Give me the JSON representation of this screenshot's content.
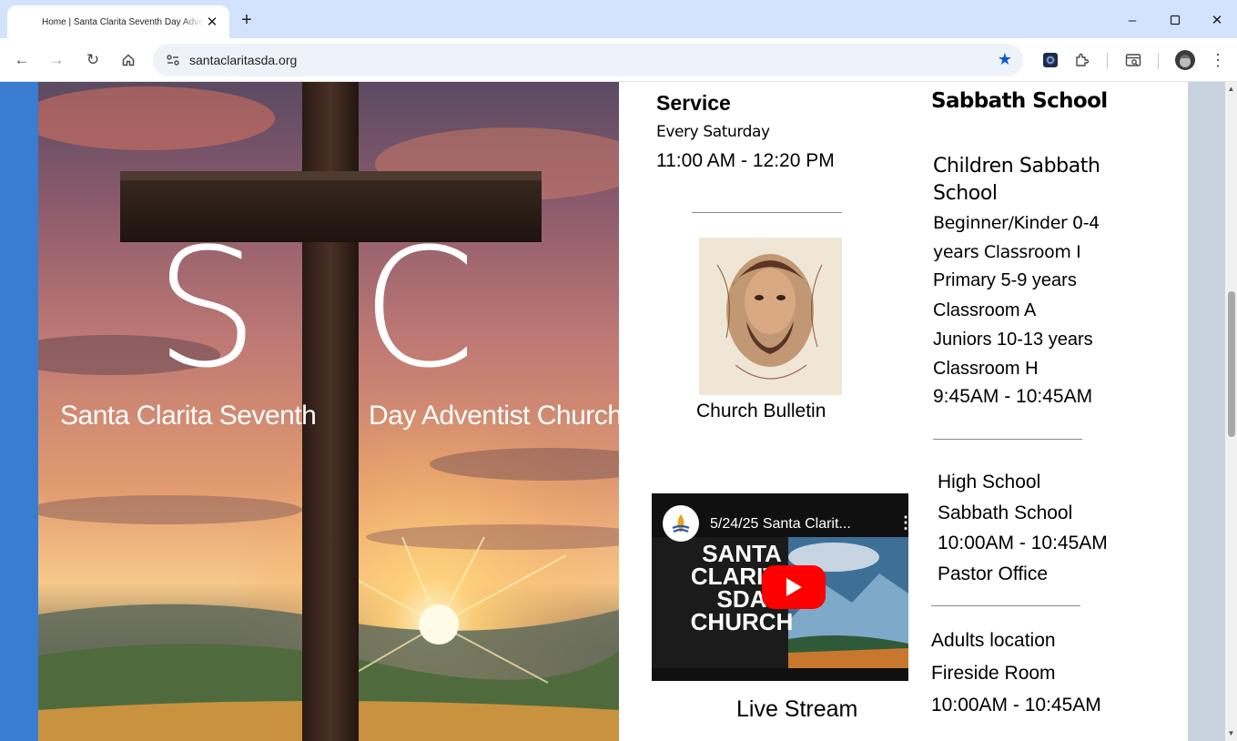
{
  "browser": {
    "tab_title": "Home | Santa Clarita Seventh Day Adventist Church",
    "url": "santaclaritasda.org",
    "window_controls": {
      "minimize": "–",
      "maximize": "☐",
      "close": "✕"
    }
  },
  "hero": {
    "logo_letters": [
      "S",
      "C"
    ],
    "caption_left": "Santa Clarita Seventh",
    "caption_right": "Day Adventist Church"
  },
  "service": {
    "heading": "Service",
    "day": "Every Saturday",
    "time": "11:00 AM - 12:20 PM"
  },
  "bulletin": {
    "label": "Church Bulletin"
  },
  "video": {
    "title": "5/24/25 Santa Clarit...",
    "thumb_lines": [
      "SANTA",
      "CLARITA",
      "SDA",
      "CHURCH"
    ],
    "label": "Live Stream"
  },
  "sabbath_school": {
    "heading": "Sabbath School",
    "children_title": [
      "Children Sabbath",
      "School"
    ],
    "children_lines": [
      "Beginner/Kinder 0-4",
      "years Classroom I",
      "Primary 5-9 years",
      "Classroom A",
      "Juniors 10-13 years",
      "Classroom H",
      "9:45AM - 10:45AM"
    ],
    "high_school_lines": [
      "High School",
      "Sabbath School",
      "10:00AM - 10:45AM",
      "Pastor Office"
    ],
    "adults_lines": [
      "Adults location",
      "Fireside Room",
      "10:00AM - 10:45AM"
    ]
  },
  "colors": {
    "tabstrip": "#d3e3fd",
    "accent_blue": "#0b57d0",
    "youtube_red": "#ff0000",
    "left_edge": "#3a7cd0"
  }
}
